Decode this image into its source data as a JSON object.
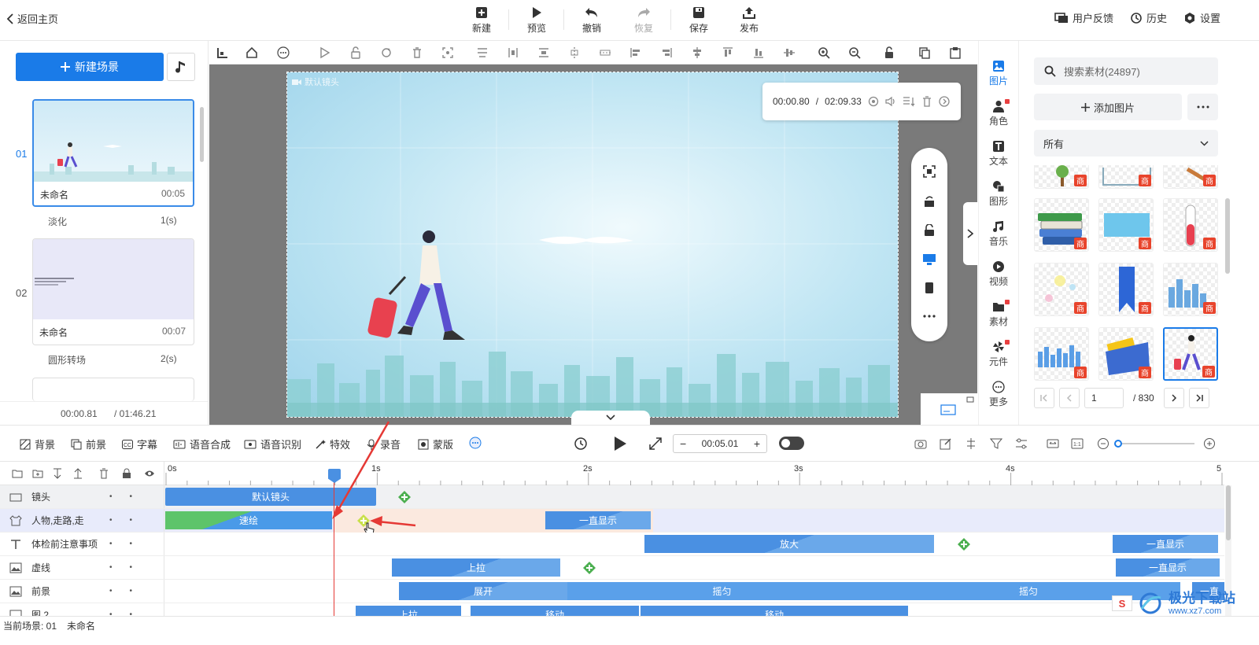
{
  "topbar": {
    "back": "返回主页",
    "new": "新建",
    "preview": "预览",
    "undo": "撤销",
    "redo": "恢复",
    "save": "保存",
    "publish": "发布",
    "feedback": "用户反馈",
    "history": "历史",
    "settings": "设置"
  },
  "left": {
    "new_scene": "新建场景",
    "scenes": [
      {
        "num": "01",
        "name": "未命名",
        "dur": "00:05",
        "transition": "淡化",
        "trans_dur": "1(s)"
      },
      {
        "num": "02",
        "name": "未命名",
        "dur": "00:07",
        "transition": "圆形转场",
        "trans_dur": "2(s)"
      }
    ],
    "time_current": "00:00.81",
    "time_total": "/ 01:46.21"
  },
  "stage": {
    "camera_label": "默认镜头",
    "time_current": "00:00.80",
    "time_sep": "/",
    "time_total": "02:09.33"
  },
  "sidetabs": [
    "图片",
    "角色",
    "文本",
    "图形",
    "音乐",
    "视频",
    "素材",
    "元件",
    "更多"
  ],
  "right": {
    "search_placeholder": "搜索素材(24897)",
    "add_image": "添加图片",
    "filter": "所有",
    "page": "1",
    "page_total": "/ 830",
    "badge": "商"
  },
  "tltool": {
    "bg": "背景",
    "fg": "前景",
    "subtitle": "字幕",
    "tts": "语音合成",
    "asr": "语音识别",
    "effect": "特效",
    "record": "录音",
    "mask": "蒙版",
    "timecode": "00:05.01"
  },
  "ruler": [
    "0s",
    "1s",
    "2s",
    "3s",
    "4s",
    "5"
  ],
  "tracks": [
    {
      "name": "镜头",
      "clips": [
        "默认镜头"
      ]
    },
    {
      "name": "人物,走路,走",
      "clips": [
        "速绘",
        "一直显示"
      ]
    },
    {
      "name": "体检前注意事项",
      "clips": [
        "放大",
        "一直显示"
      ]
    },
    {
      "name": "虚线",
      "clips": [
        "上拉",
        "一直显示"
      ]
    },
    {
      "name": "前景",
      "clips": [
        "展开",
        "摇匀",
        "摇匀",
        "一直"
      ]
    },
    {
      "name": "图 2",
      "clips": [
        "上拉",
        "移动",
        "移动"
      ]
    }
  ],
  "status": {
    "scene": "当前场景: 01",
    "name": "未命名"
  },
  "watermark": {
    "text": "极光下载站",
    "url": "www.xz7.com"
  },
  "colors": {
    "accent": "#1a7be8",
    "clip": "#4a90e2",
    "keyframe": "#4caf50",
    "playhead": "#e53935"
  }
}
